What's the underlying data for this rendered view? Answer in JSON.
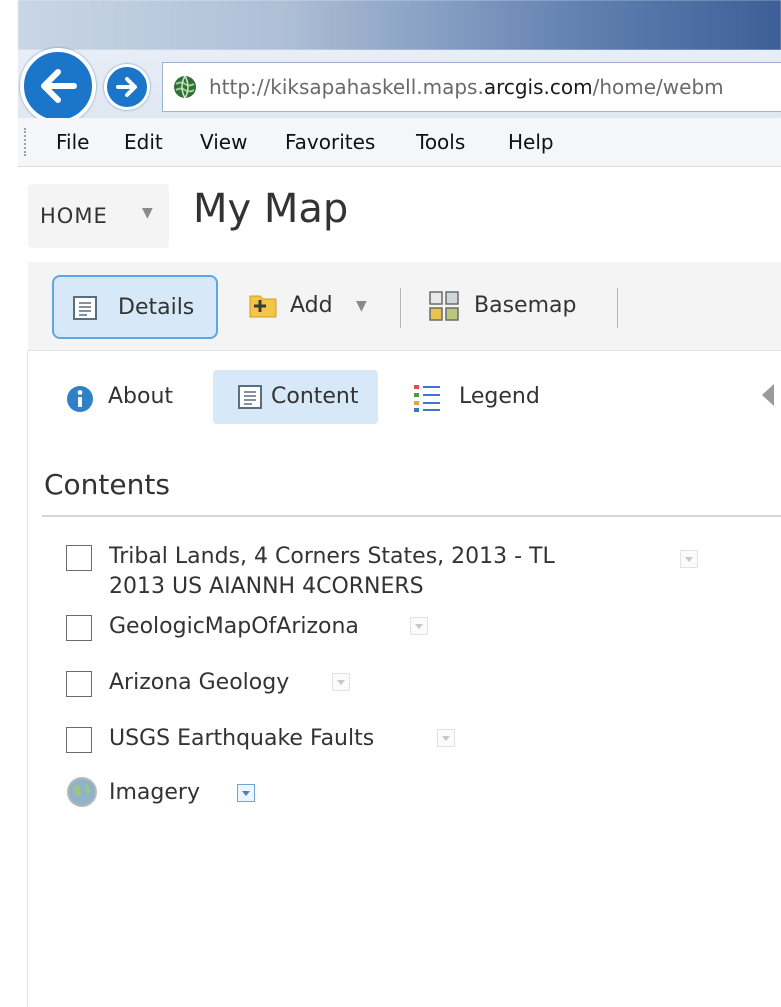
{
  "browser": {
    "url_prefix": "http://kiksapahaskell.maps.",
    "url_domain": "arcgis.com",
    "url_suffix": "/home/webm",
    "back_icon": "back-arrow-icon",
    "forward_icon": "forward-arrow-icon",
    "site_icon": "globe-icon"
  },
  "menubar": {
    "items": [
      "File",
      "Edit",
      "View",
      "Favorites",
      "Tools",
      "Help"
    ]
  },
  "header": {
    "home_label": "HOME",
    "title": "My Map"
  },
  "toolbar": {
    "details_label": "Details",
    "add_label": "Add",
    "basemap_label": "Basemap"
  },
  "tabs": {
    "about_label": "About",
    "content_label": "Content",
    "legend_label": "Legend",
    "active": "Content"
  },
  "contents": {
    "heading": "Contents",
    "layers": [
      {
        "name_line1": "Tribal Lands, 4 Corners States, 2013 - TL",
        "name_line2": "2013 US AIANNH 4CORNERS",
        "checked": false
      },
      {
        "name": "GeologicMapOfArizona",
        "checked": false
      },
      {
        "name": "Arizona Geology",
        "checked": false
      },
      {
        "name": "USGS Earthquake Faults",
        "checked": false
      },
      {
        "name": "Imagery",
        "type": "basemap",
        "icon": "globe-icon"
      }
    ]
  },
  "colors": {
    "accent": "#1b75c9",
    "active_bg": "#d7e9f8",
    "active_border": "#5fa7e0"
  }
}
